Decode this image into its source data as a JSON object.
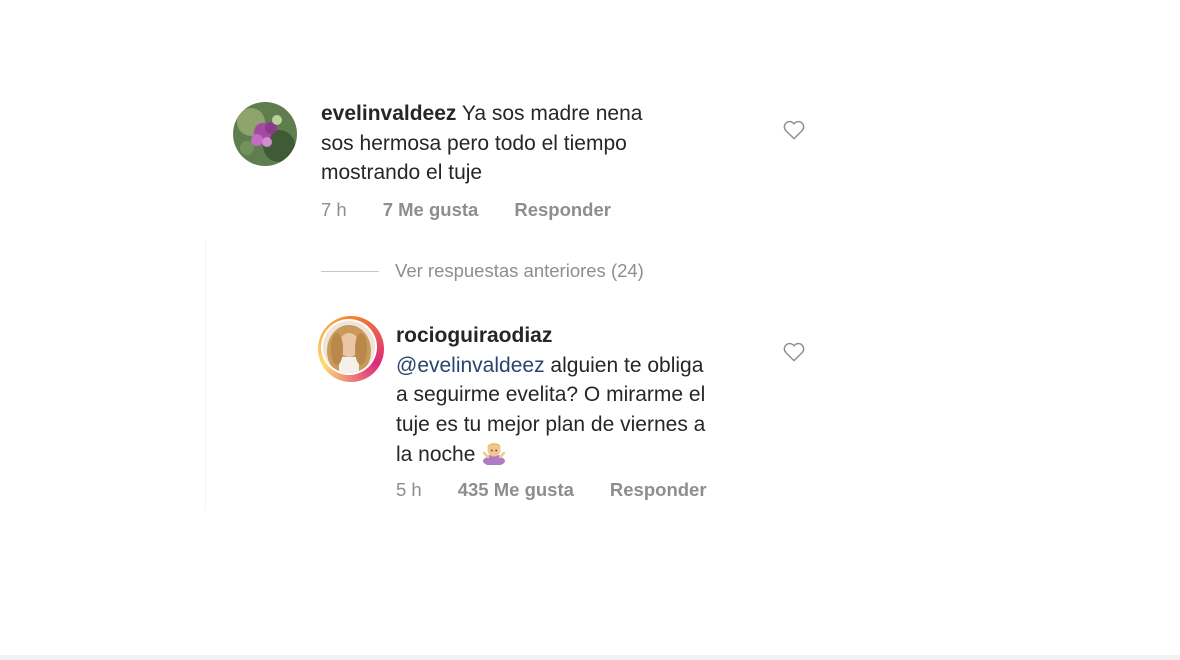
{
  "comments": [
    {
      "username": "evelinvaldeez",
      "lines": [
        "Ya sos madre nena",
        "sos hermosa pero todo el tiempo",
        "mostrando el tuje"
      ],
      "time": "7 h",
      "likes": "7 Me gusta",
      "reply": "Responder"
    },
    {
      "username": "rocioguiraodiaz",
      "mention": "@evelinvaldeez",
      "lines": [
        "alguien te obliga",
        "a seguirme evelita? O mirarme el",
        "tuje es tu mejor plan de viernes a",
        "la noche"
      ],
      "time": "5 h",
      "likes": "435 Me gusta",
      "reply": "Responder"
    }
  ],
  "view_replies": "Ver respuestas anteriores (24)",
  "icons": {
    "heart": "heart-outline-icon",
    "emoji": "person-shrugging-emoji"
  },
  "colors": {
    "text": "#262626",
    "muted": "#8e8e8e",
    "mention": "#29446e"
  }
}
